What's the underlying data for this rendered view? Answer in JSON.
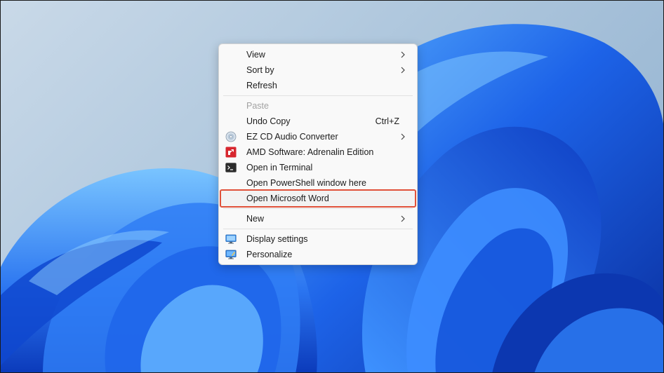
{
  "context_menu": {
    "items": [
      {
        "label": "View"
      },
      {
        "label": "Sort by"
      },
      {
        "label": "Refresh"
      },
      {
        "label": "Paste"
      },
      {
        "label": "Undo Copy",
        "shortcut": "Ctrl+Z"
      },
      {
        "label": "EZ CD Audio Converter",
        "icon": "cd-icon"
      },
      {
        "label": "AMD Software: Adrenalin Edition",
        "icon": "amd-icon"
      },
      {
        "label": "Open in Terminal",
        "icon": "terminal-icon"
      },
      {
        "label": "Open PowerShell window here"
      },
      {
        "label": "Open Microsoft Word"
      },
      {
        "label": "New"
      },
      {
        "label": "Display settings",
        "icon": "display-icon"
      },
      {
        "label": "Personalize",
        "icon": "personalize-icon"
      }
    ],
    "highlight_color": "#e0513a",
    "disabled_color": "#a2a2a2"
  },
  "wallpaper": {
    "colors": {
      "background": "#b3cadf",
      "bloom_dark": "#0a3bbf",
      "bloom_mid": "#1d63e8",
      "bloom_light": "#4aa0ff"
    }
  }
}
